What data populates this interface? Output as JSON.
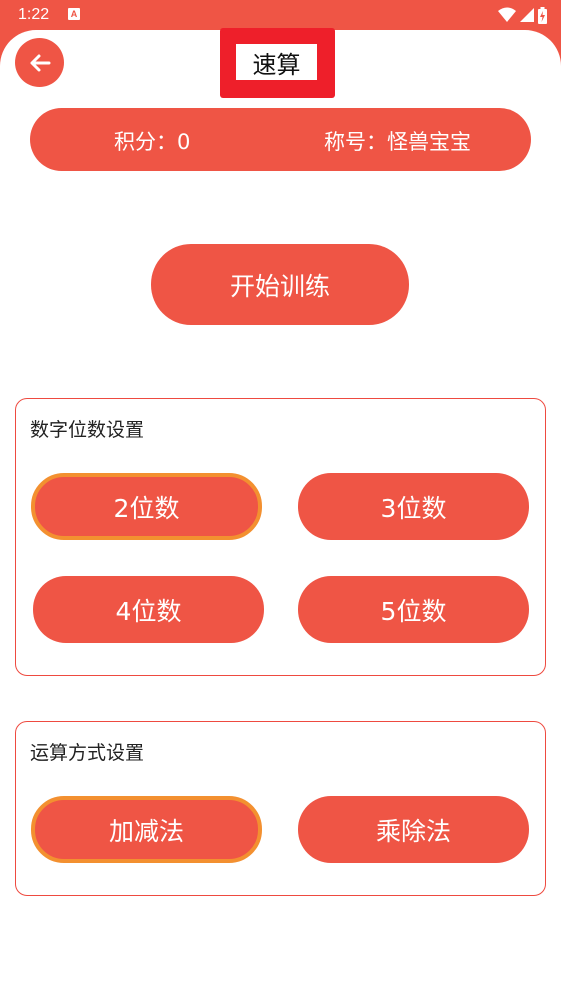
{
  "status_bar": {
    "time": "1:22",
    "notification_icon": "A"
  },
  "header": {
    "title": "速算",
    "back_icon": "arrow-left-icon"
  },
  "score_bar": {
    "score": "积分：0",
    "rank": "称号：怪兽宝宝"
  },
  "start_button": {
    "label": "开始训练"
  },
  "digits_panel": {
    "title": "数字位数设置",
    "options": [
      {
        "label": "2位数",
        "selected": true
      },
      {
        "label": "3位数",
        "selected": false
      },
      {
        "label": "4位数",
        "selected": false
      },
      {
        "label": "5位数",
        "selected": false
      }
    ]
  },
  "ops_panel": {
    "title": "运算方式设置",
    "options": [
      {
        "label": "加减法",
        "selected": true
      },
      {
        "label": "乘除法",
        "selected": false
      }
    ]
  },
  "colors": {
    "primary": "#ef5545",
    "selected_border": "#f39030",
    "title_highlight": "#ee1f2a"
  }
}
